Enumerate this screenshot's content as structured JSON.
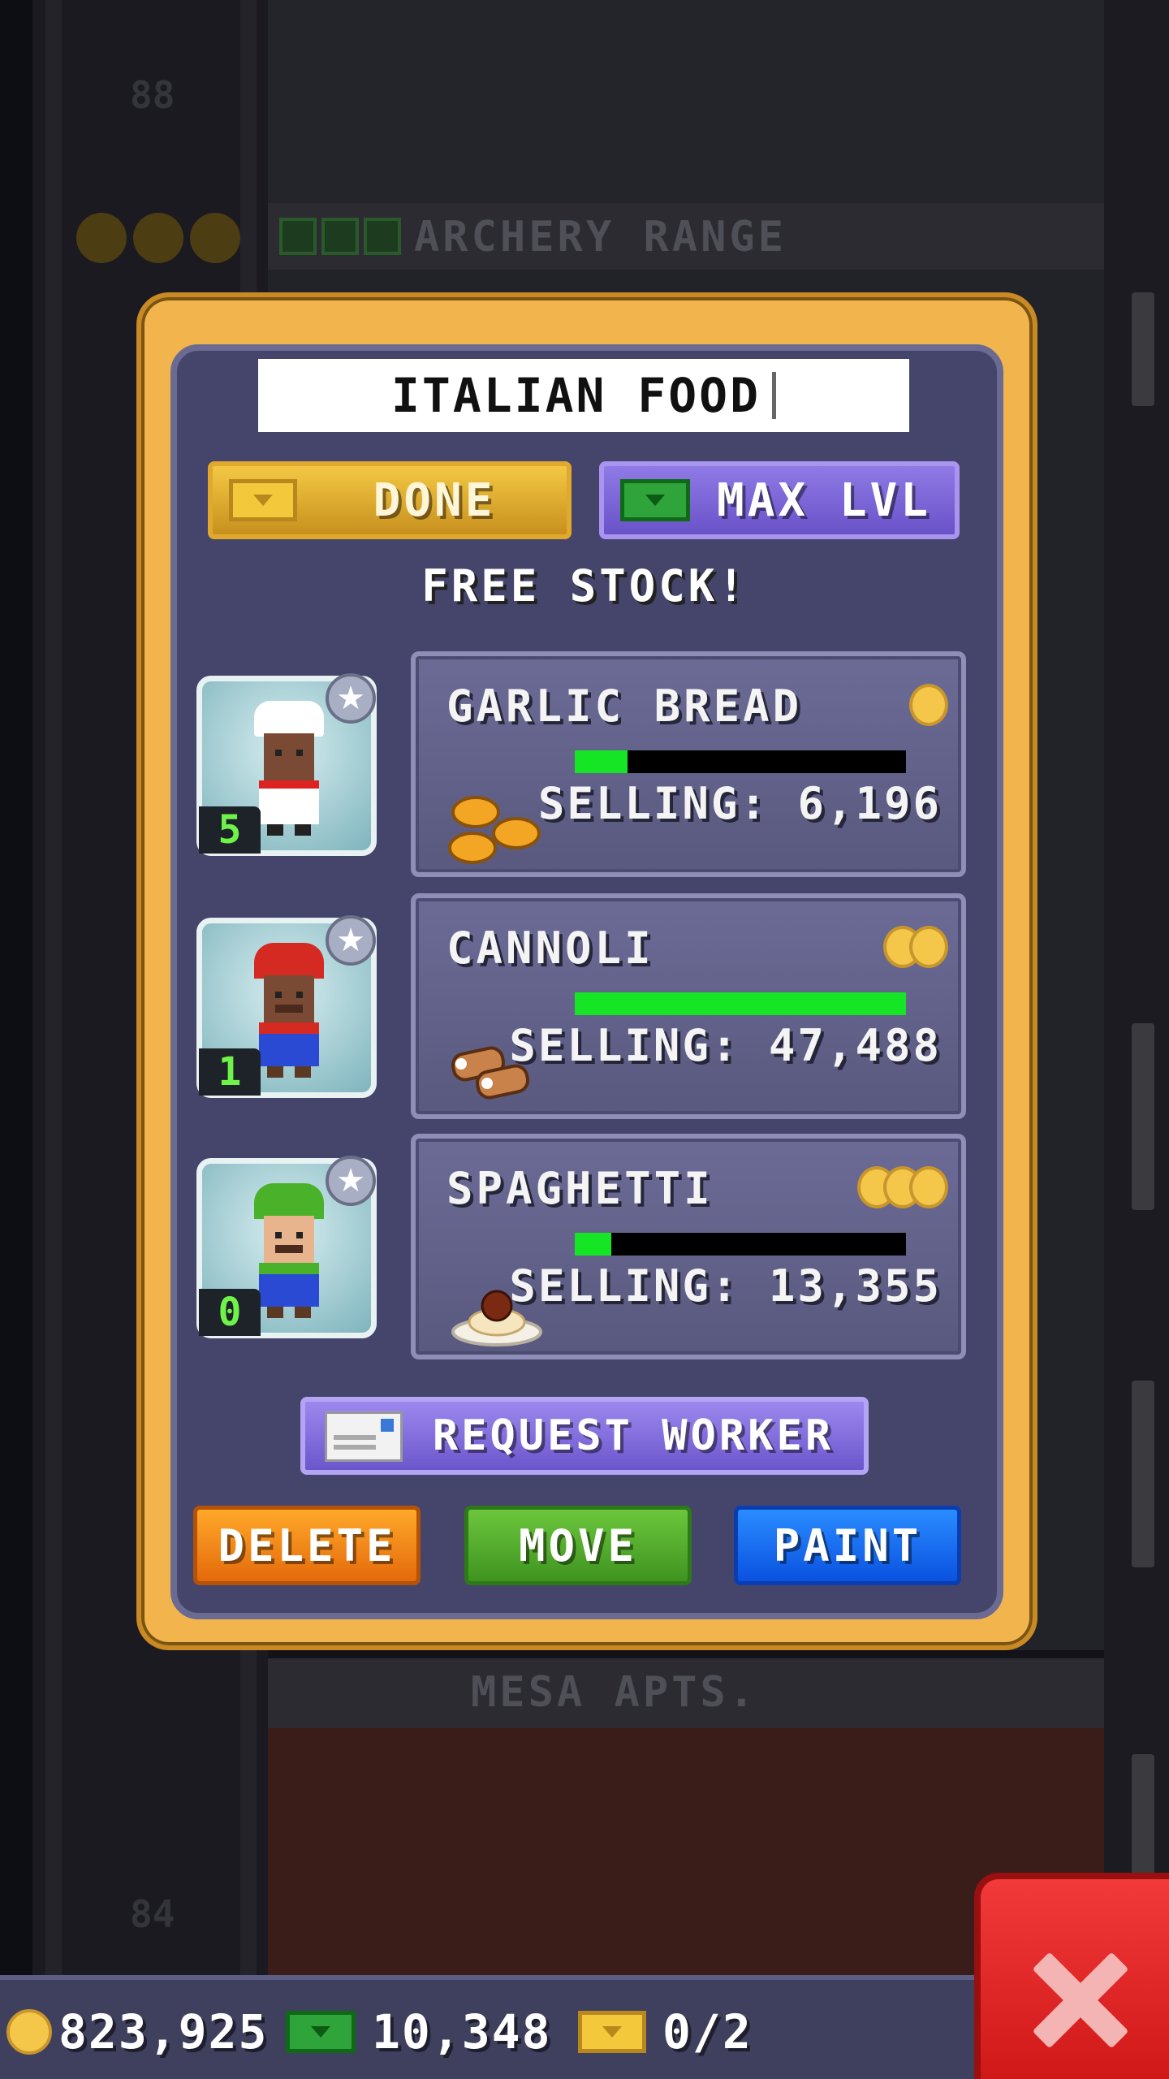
{
  "background": {
    "top_floor_name": "ARCHERY RANGE",
    "bottom_floor_name": "MESA APTS."
  },
  "dialog": {
    "floor_name_value": "ITALIAN FOOD",
    "done_label": "DONE",
    "max_level_label": "MAX LVL",
    "free_stock_label": "FREE STOCK!",
    "products": [
      {
        "name": "GARLIC BREAD",
        "selling_text": "SELLING: 6,196",
        "stock_fraction": 0.16,
        "coin_count": 1,
        "food_icon": "garlic-bread-icon",
        "worker_level": "5",
        "worker_icon": "chef-worker-icon"
      },
      {
        "name": "CANNOLI",
        "selling_text": "SELLING: 47,488",
        "stock_fraction": 1.0,
        "coin_count": 2,
        "food_icon": "cannoli-icon",
        "worker_level": "1",
        "worker_icon": "red-plumber-worker-icon"
      },
      {
        "name": "SPAGHETTI",
        "selling_text": "SELLING: 13,355",
        "stock_fraction": 0.11,
        "coin_count": 3,
        "food_icon": "spaghetti-icon",
        "worker_level": "0",
        "worker_icon": "green-plumber-worker-icon"
      }
    ],
    "request_worker_label": "REQUEST WORKER",
    "delete_label": "DELETE",
    "move_label": "MOVE",
    "paint_label": "PAINT"
  },
  "status_bar": {
    "coins": "823,925",
    "tower_bux": "10,348",
    "tickets": "0/2"
  },
  "colors": {
    "dialog_frame": "#f2b54d",
    "dialog_panel": "#45456b",
    "progress_fill": "#16e526",
    "delete": "#e46a0a",
    "move": "#3f9420",
    "paint": "#0a52e0",
    "close": "#d01818"
  }
}
